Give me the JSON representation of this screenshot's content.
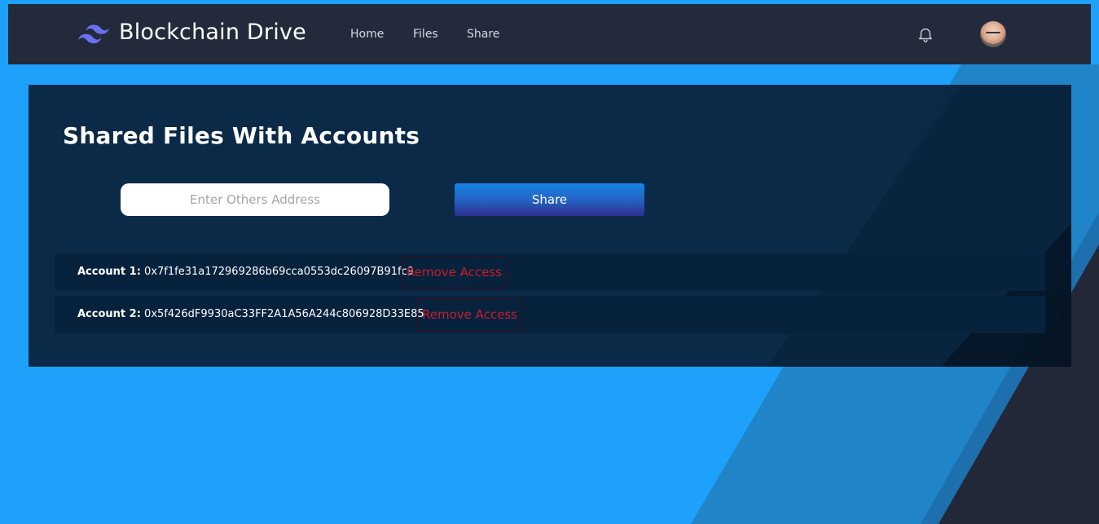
{
  "navbar": {
    "brand": "Blockchain Drive",
    "links": [
      "Home",
      "Files",
      "Share"
    ]
  },
  "main": {
    "title": "Shared Files With Accounts",
    "address_input_placeholder": "Enter Others Address",
    "share_button_label": "Share",
    "accounts": [
      {
        "label": "Account 1:",
        "address": "0x7f1fe31a172969286b69cca0553dc26097B91fc9",
        "action": "Remove Access"
      },
      {
        "label": "Account 2:",
        "address": "0x5f426dF9930aC33FF2A1A56A244c806928D33E85",
        "action": "Remove Access"
      }
    ]
  },
  "colors": {
    "background": "#1ea1fb",
    "navbar": "#222a3b",
    "panel": "#092642",
    "remove_access": "#c81d2e",
    "accent_logo": "#6b6ff0"
  },
  "icons": [
    "tailwind-logo-icon",
    "bell-icon",
    "user-avatar"
  ]
}
